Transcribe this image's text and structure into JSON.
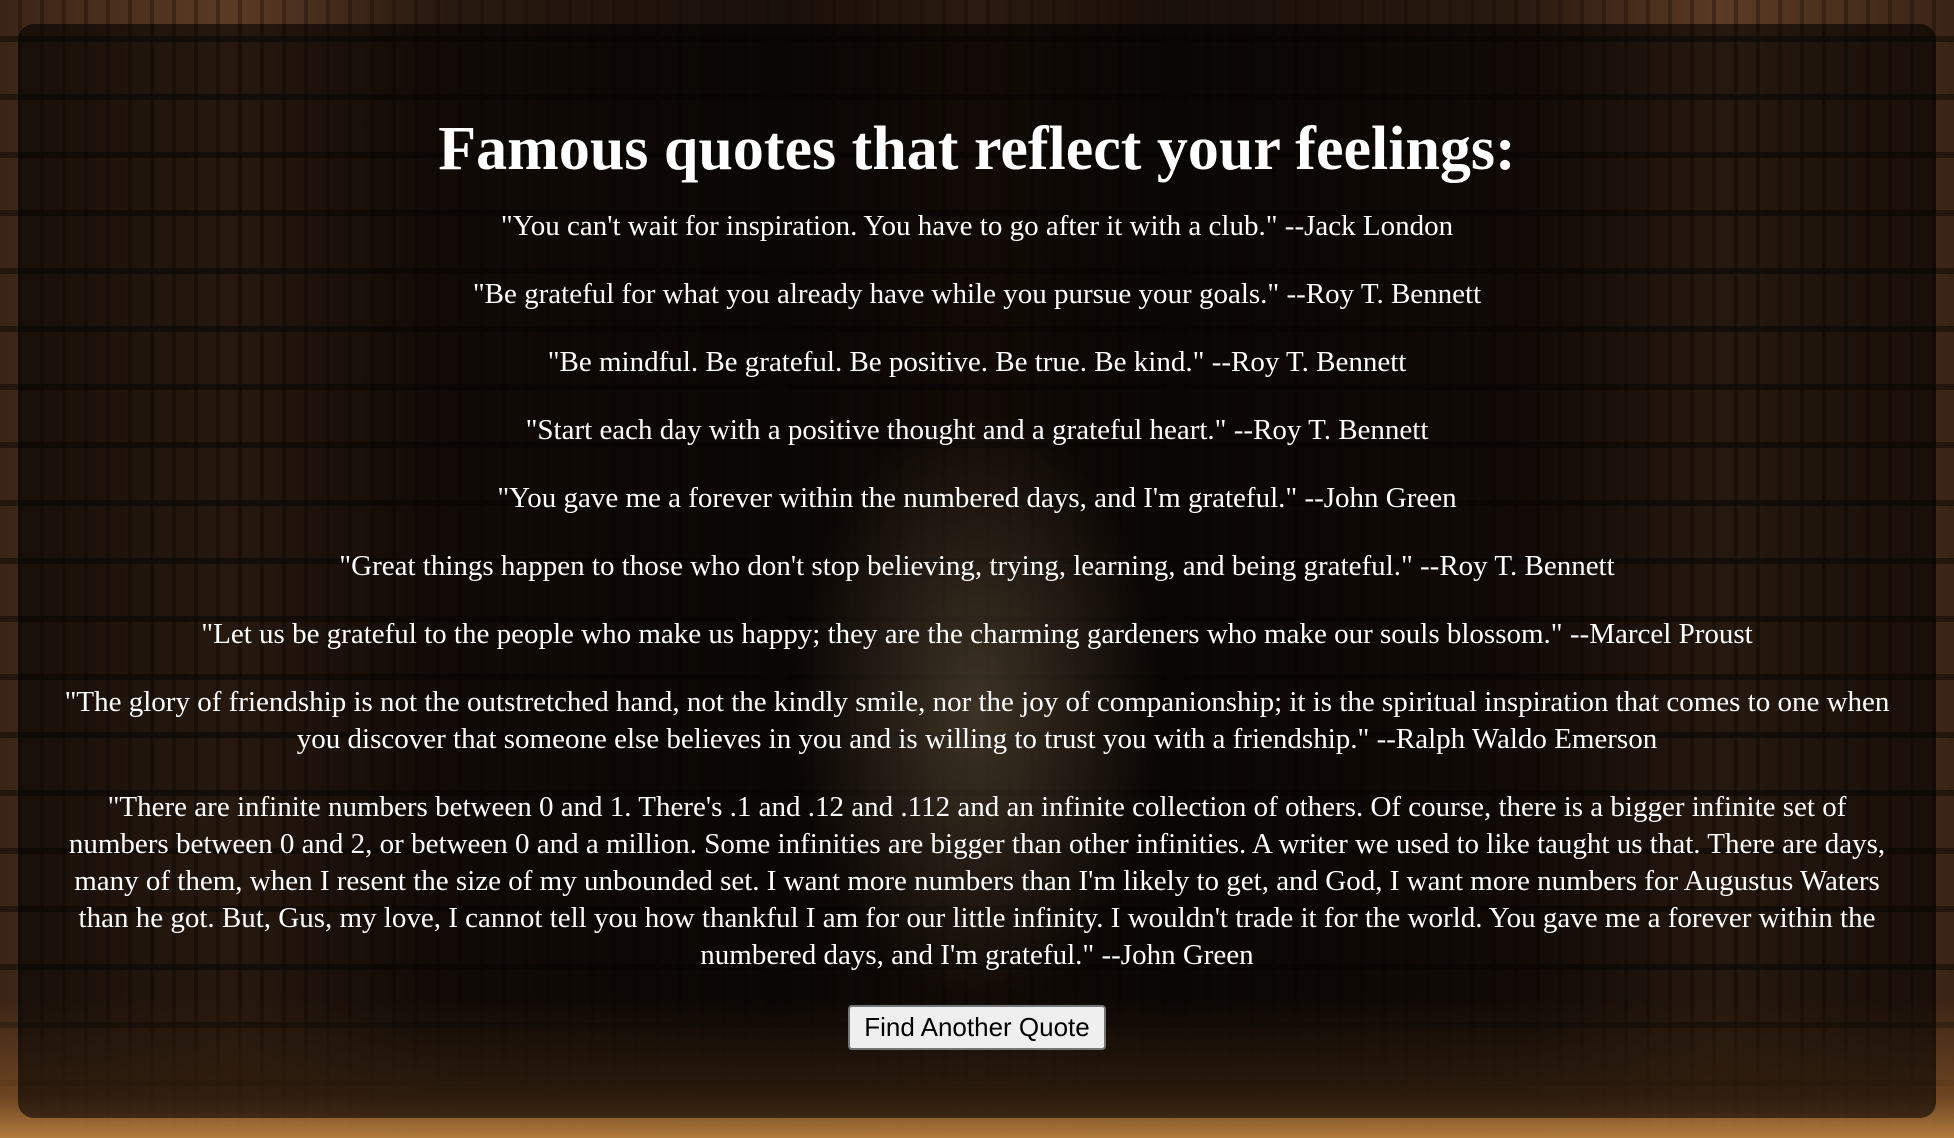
{
  "page": {
    "title": "Famous quotes that reflect your feelings:"
  },
  "quotes": [
    "\"You can't wait for inspiration. You have to go after it with a club.\" --Jack London",
    "\"Be grateful for what you already have while you pursue your goals.\" --Roy T. Bennett",
    "\"Be mindful. Be grateful. Be positive. Be true. Be kind.\" --Roy T. Bennett",
    "\"Start each day with a positive thought and a grateful heart.\" --Roy T. Bennett",
    "\"You gave me a forever within the numbered days, and I'm grateful.\" --John Green",
    "\"Great things happen to those who don't stop believing, trying, learning, and being grateful.\" --Roy T. Bennett",
    "\"Let us be grateful to the people who make us happy; they are the charming gardeners who make our souls blossom.\" --Marcel Proust",
    "\"The glory of friendship is not the outstretched hand, not the kindly smile, nor the joy of companionship; it is the spiritual inspiration that comes to one when you discover that someone else believes in you and is willing to trust you with a friendship.\" --Ralph Waldo Emerson",
    "\"There are infinite numbers between 0 and 1. There's .1 and .12 and .112 and an infinite collection of others. Of course, there is a bigger infinite set of numbers between 0 and 2, or between 0 and a million. Some infinities are bigger than other infinities. A writer we used to like taught us that. There are days, many of them, when I resent the size of my unbounded set. I want more numbers than I'm likely to get, and God, I want more numbers for Augustus Waters than he got. But, Gus, my love, I cannot tell you how thankful I am for our little infinity. I wouldn't trade it for the world. You gave me a forever within the numbered days, and I'm grateful.\" --John Green"
  ],
  "actions": {
    "find_another_label": "Find Another Quote"
  },
  "colors": {
    "text": "#ffffff",
    "panel_overlay": "rgba(0,0,0,0.58)",
    "button_bg": "#efefef"
  }
}
